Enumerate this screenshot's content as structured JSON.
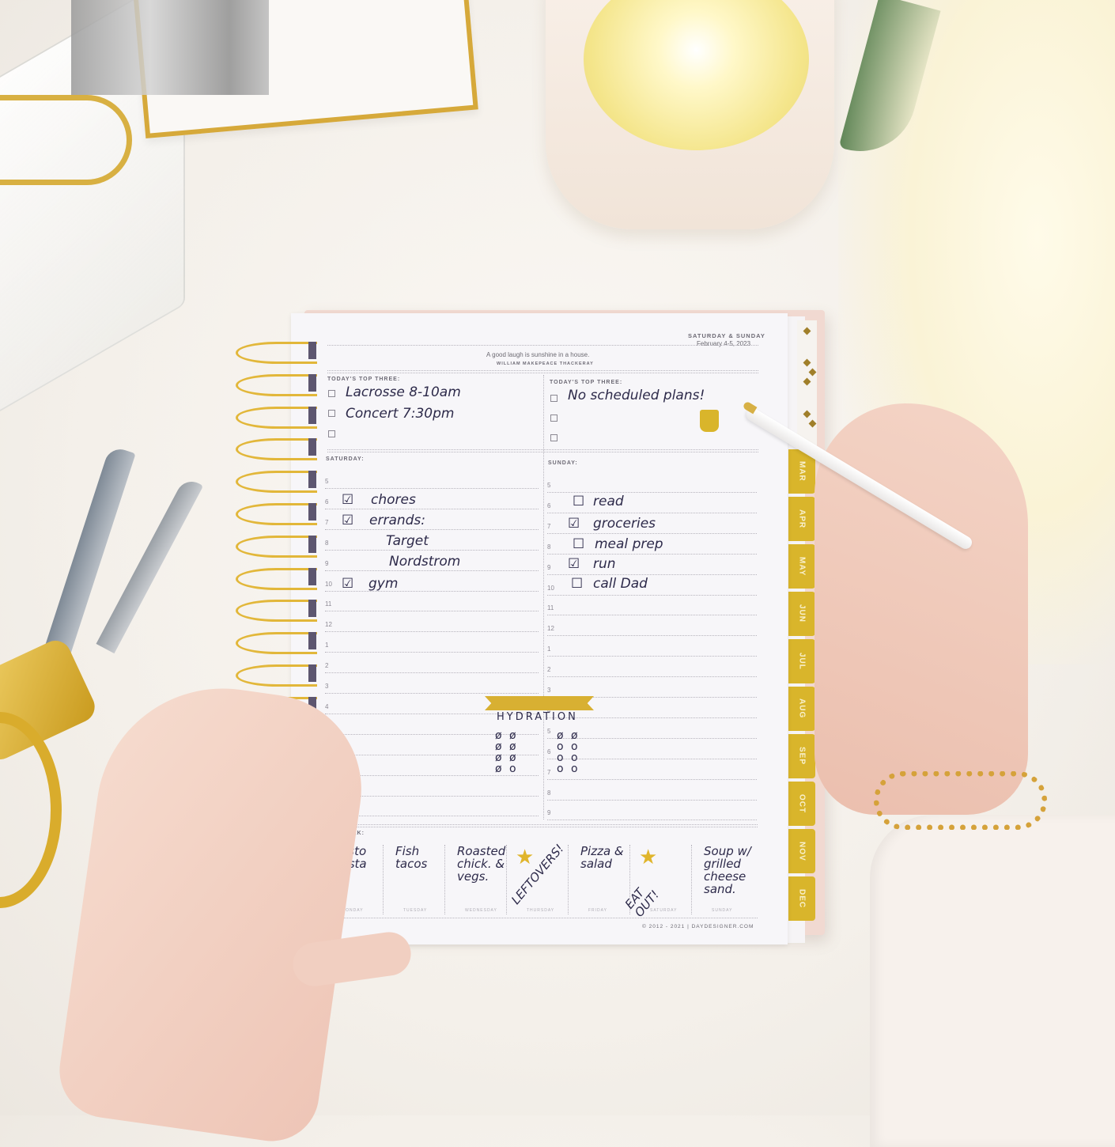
{
  "scene": {
    "description": "Overhead photo of a spiral day planner open to a weekend page on a white desk",
    "colors": {
      "gold_accent": "#d9b52b",
      "ink": "#2d2a4a",
      "paper": "#f7f6f9",
      "cover": "#f1d9d1"
    }
  },
  "planner": {
    "header": {
      "days": "SATURDAY & SUNDAY",
      "date": "February 4-5, 2023",
      "quote": "A good laugh is sunshine in a house.",
      "quote_author": "WILLIAM MAKEPEACE THACKERAY"
    },
    "saturday": {
      "top_three_label": "TODAY'S TOP THREE:",
      "top_three": [
        "Lacrosse 8-10am",
        "Concert 7:30pm",
        ""
      ],
      "day_label": "SATURDAY:",
      "hours": [
        "5",
        "6",
        "7",
        "8",
        "9",
        "10",
        "11",
        "12",
        "1",
        "2",
        "3",
        "4",
        "5",
        "6",
        "7",
        "8",
        "9"
      ],
      "entries": [
        {
          "hour": "6",
          "text": "chores",
          "checked": true
        },
        {
          "hour": "7",
          "text": "errands:",
          "checked": true
        },
        {
          "hour": "8",
          "text": "Target",
          "checked": null
        },
        {
          "hour": "9",
          "text": "Nordstrom",
          "checked": null
        },
        {
          "hour": "10",
          "text": "gym",
          "checked": true
        }
      ]
    },
    "sunday": {
      "top_three_label": "TODAY'S TOP THREE:",
      "top_three": [
        "No scheduled plans!",
        "",
        ""
      ],
      "day_label": "SUNDAY:",
      "hours": [
        "5",
        "6",
        "7",
        "8",
        "9",
        "10",
        "11",
        "12",
        "1",
        "2",
        "3",
        "4",
        "5",
        "6",
        "7",
        "8",
        "9"
      ],
      "entries": [
        {
          "hour": "6",
          "text": "read",
          "checked": false
        },
        {
          "hour": "7",
          "text": "groceries",
          "checked": true
        },
        {
          "hour": "8",
          "text": "meal prep",
          "checked": false
        },
        {
          "hour": "9",
          "text": "run",
          "checked": true
        },
        {
          "hour": "10",
          "text": "call Dad",
          "checked": false
        }
      ]
    },
    "hydration": {
      "title": "HYDRATION",
      "saturday_glasses": {
        "total": 8,
        "done": 7
      },
      "sunday_glasses": {
        "total": 8,
        "done": 2
      }
    },
    "next_week": {
      "label": "NEXT WEEK:",
      "days": [
        {
          "day": "MONDAY",
          "meal": "Pesto pasta"
        },
        {
          "day": "TUESDAY",
          "meal": "Fish tacos"
        },
        {
          "day": "WEDNESDAY",
          "meal": "Roasted chick. & vegs."
        },
        {
          "day": "THURSDAY",
          "meal": "LEFTOVERS!",
          "star": true
        },
        {
          "day": "FRIDAY",
          "meal": "Pizza & salad"
        },
        {
          "day": "SATURDAY",
          "meal": "EAT OUT!",
          "star": true
        },
        {
          "day": "SUNDAY",
          "meal": "Soup w/ grilled cheese sand."
        }
      ]
    },
    "footer": "© 2012 - 2021 | DAYDESIGNER.COM",
    "month_tabs": [
      "MAR",
      "APR",
      "MAY",
      "JUN",
      "JUL",
      "AUG",
      "SEP",
      "OCT",
      "NOV",
      "DEC"
    ]
  }
}
